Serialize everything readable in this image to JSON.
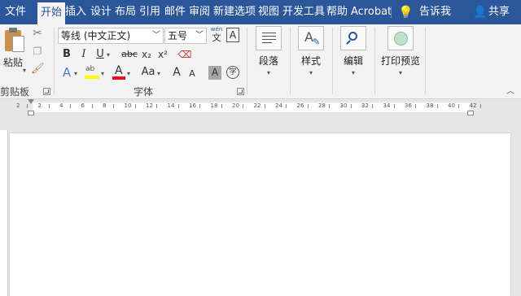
{
  "tabs": [
    "文件",
    "开始",
    "插入",
    "设计",
    "布局",
    "引用",
    "邮件",
    "审阅",
    "新建选项",
    "视图",
    "开发工具",
    "帮助",
    "Acrobat"
  ],
  "tell_me": "告诉我",
  "share": "共享",
  "clipboard": {
    "paste": "粘贴",
    "label": "剪贴板"
  },
  "font": {
    "name": "等线 (中文正文)",
    "size": "五号",
    "phonetic": "wén",
    "phonetic_char": "文",
    "char_border": "A",
    "bold": "B",
    "italic": "I",
    "underline": "U",
    "strike": "abc",
    "subscript": "x₂",
    "superscript": "x²",
    "aa": "Aa",
    "grow": "A",
    "shrink": "A",
    "shading": "A",
    "enclose": "字",
    "label": "字体"
  },
  "groups": {
    "paragraph": "段落",
    "styles": "样式",
    "editing": "编辑",
    "print_preview": "打印预览"
  },
  "ruler_ticks": [
    "2",
    "2",
    "4",
    "6",
    "8",
    "10",
    "12",
    "14",
    "16",
    "18",
    "20",
    "22",
    "24",
    "26",
    "28",
    "30",
    "32",
    "34",
    "36",
    "38",
    "40",
    "42"
  ],
  "colors": {
    "ribbon_blue": "#2b579a",
    "highlight": "#ffff00",
    "font_red": "#e81123"
  }
}
